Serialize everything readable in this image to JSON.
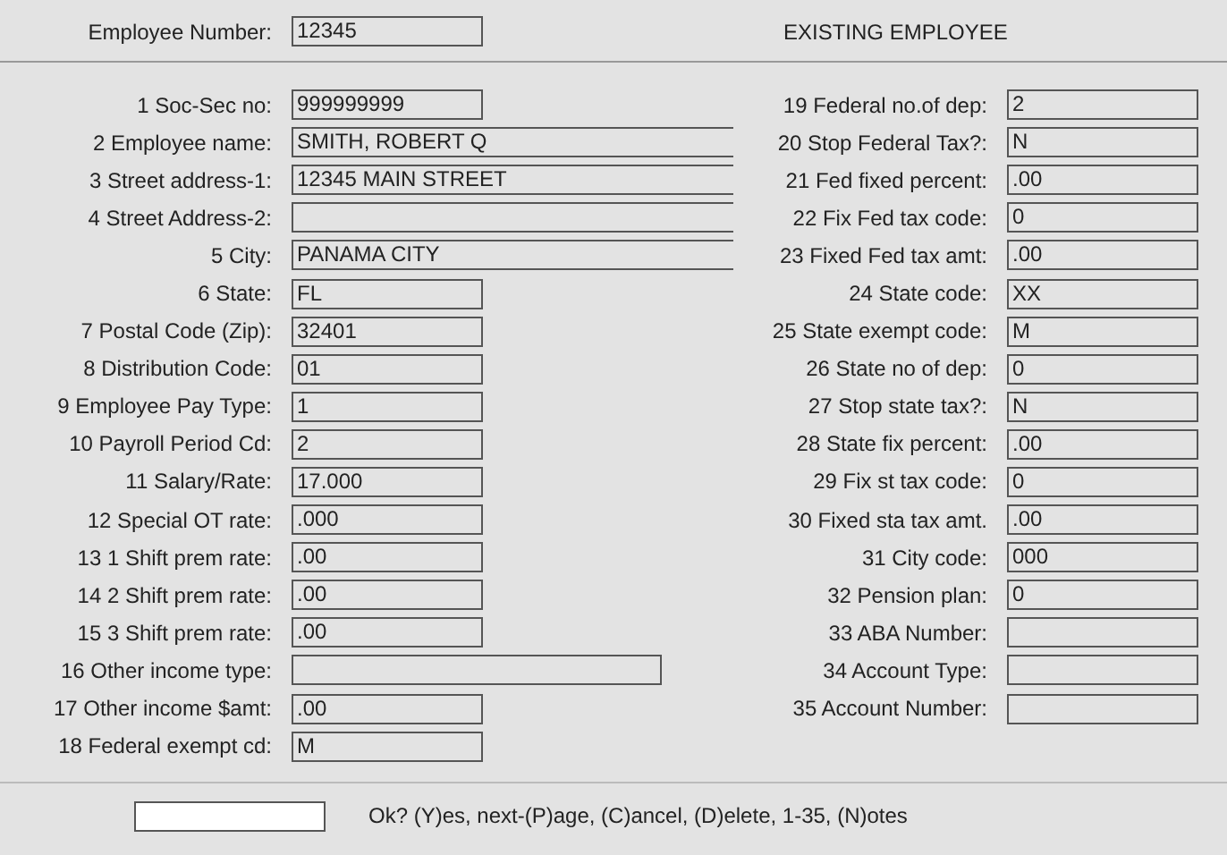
{
  "employee_number": {
    "label": "Employee Number:",
    "value": "12345"
  },
  "status": "EXISTING EMPLOYEE",
  "left_fields": [
    {
      "label": "1 Soc-Sec no:",
      "value": "999999999",
      "kind": "short"
    },
    {
      "label": "2 Employee name:",
      "value": "SMITH, ROBERT Q",
      "kind": "long"
    },
    {
      "label": "3 Street address-1:",
      "value": "12345 MAIN STREET",
      "kind": "long"
    },
    {
      "label": "4 Street Address-2:",
      "kind": "long"
    },
    {
      "label": "5 City:",
      "value": "PANAMA CITY",
      "kind": "long"
    },
    {
      "label": "6 State:",
      "value": "FL",
      "kind": "short"
    },
    {
      "label": "7 Postal Code (Zip):",
      "value": "32401",
      "kind": "short"
    },
    {
      "label": "8 Distribution Code:",
      "value": "01",
      "kind": "short"
    },
    {
      "label": "9 Employee Pay Type:",
      "value": "1",
      "kind": "short"
    },
    {
      "label": "10 Payroll Period Cd:",
      "value": "2",
      "kind": "short"
    },
    {
      "label": "11 Salary/Rate:",
      "value": "17.000",
      "kind": "short"
    },
    {
      "label": "12 Special OT rate:",
      "value": ".000",
      "kind": "short"
    },
    {
      "label": "13 1 Shift prem rate:",
      "value": ".00",
      "kind": "short"
    },
    {
      "label": "14 2 Shift prem rate:",
      "value": ".00",
      "kind": "short"
    },
    {
      "label": "15 3 Shift prem rate:",
      "value": ".00",
      "kind": "short"
    },
    {
      "label": "16 Other income type:",
      "kind": "medium"
    },
    {
      "label": "17 Other income $amt:",
      "value": ".00",
      "kind": "short"
    },
    {
      "label": "18 Federal exempt cd:",
      "value": "M",
      "kind": "short"
    }
  ],
  "right_fields": [
    {
      "label": "19 Federal no.of dep:",
      "value": "2",
      "kind": "short"
    },
    {
      "label": "20 Stop Federal Tax?:",
      "value": "N",
      "kind": "short"
    },
    {
      "label": "21 Fed fixed percent:",
      "value": ".00",
      "kind": "short"
    },
    {
      "label": "22 Fix Fed tax code:",
      "value": "0",
      "kind": "short"
    },
    {
      "label": "23 Fixed Fed tax amt:",
      "value": ".00",
      "kind": "short"
    },
    {
      "label": "24 State code:",
      "value": "XX",
      "kind": "short"
    },
    {
      "label": "25 State exempt code:",
      "value": "M",
      "kind": "short"
    },
    {
      "label": "26 State no of dep:",
      "value": "0",
      "kind": "short"
    },
    {
      "label": "27 Stop state tax?:",
      "value": "N",
      "kind": "short"
    },
    {
      "label": "28 State fix percent:",
      "value": ".00",
      "kind": "short"
    },
    {
      "label": "29 Fix st tax code:",
      "value": "0",
      "kind": "short"
    },
    {
      "label": "30 Fixed sta tax amt.",
      "value": ".00",
      "kind": "short"
    },
    {
      "label": "31 City code:",
      "value": "000",
      "kind": "short"
    },
    {
      "label": "32 Pension plan:",
      "value": "0",
      "kind": "short"
    },
    {
      "label": "33 ABA Number:",
      "kind": "short"
    },
    {
      "label": "34 Account Type:",
      "kind": "short"
    },
    {
      "label": "35 Account Number:",
      "kind": "short"
    }
  ],
  "prompt": {
    "text": "Ok? (Y)es, next-(P)age, (C)ancel, (D)elete, 1-35, (N)otes"
  }
}
